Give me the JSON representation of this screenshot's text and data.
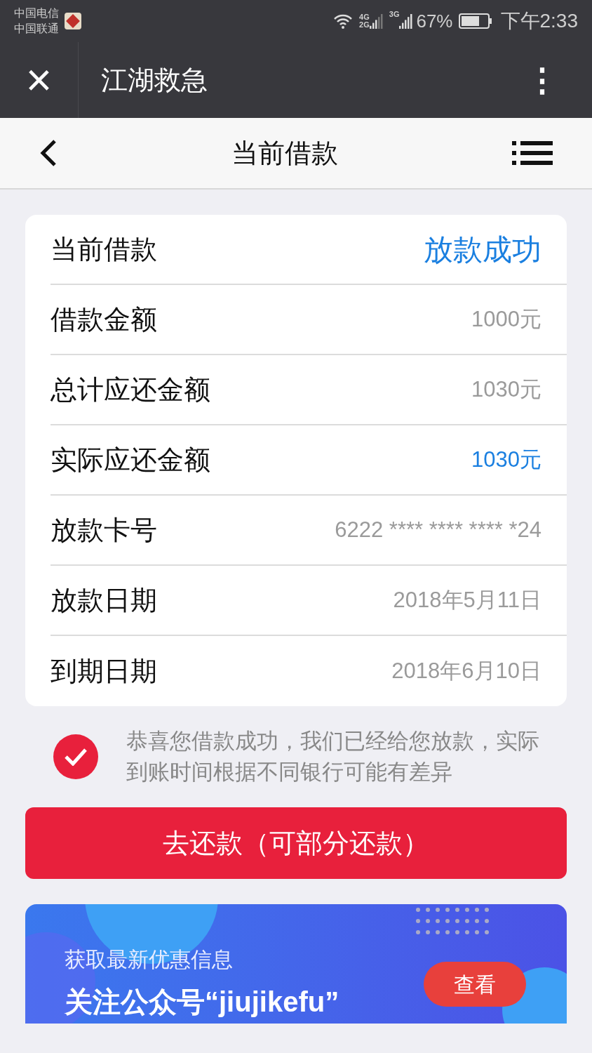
{
  "status_bar": {
    "carriers": [
      "中国电信",
      "中国联通"
    ],
    "network_1": [
      "4G",
      "2G"
    ],
    "network_2": "3G",
    "battery": "67%",
    "time": "下午2:33"
  },
  "title_bar": {
    "close": "×",
    "title": "江湖救急",
    "more": "⋮"
  },
  "nav_bar": {
    "title": "当前借款"
  },
  "loan_card": {
    "header": {
      "label": "当前借款",
      "value": "放款成功",
      "color": "#1a7fe0"
    },
    "rows": [
      {
        "label": "借款金额",
        "value": "1000元",
        "color": "#9a9a9a"
      },
      {
        "label": "总计应还金额",
        "value": "1030元",
        "color": "#9a9a9a"
      },
      {
        "label": "实际应还金额",
        "value": "1030元",
        "color": "#1a7fe0"
      },
      {
        "label": "放款卡号",
        "value": "6222 **** **** **** *24",
        "color": "#9a9a9a"
      },
      {
        "label": "放款日期",
        "value": "2018年5月11日",
        "color": "#9a9a9a"
      },
      {
        "label": "到期日期",
        "value": "2018年6月10日",
        "color": "#9a9a9a"
      }
    ]
  },
  "notice": {
    "checked": true,
    "text": "恭喜您借款成功，我们已经给您放款，实际到账时间根据不同银行可能有差异"
  },
  "repay_button": "去还款（可部分还款）",
  "banner": {
    "line_1": "获取最新优惠信息",
    "line_2": "关注公众号“jiujikefu”",
    "button": "查看"
  }
}
